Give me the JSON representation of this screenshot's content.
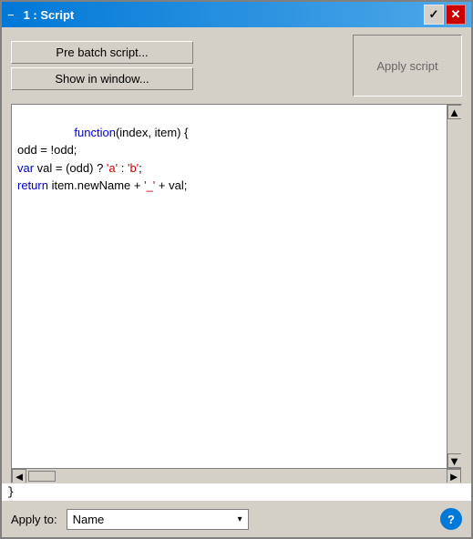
{
  "window": {
    "title": "1 : Script",
    "minus_label": "−"
  },
  "toolbar": {
    "pre_batch_label": "Pre batch script...",
    "show_in_window_label": "Show in window...",
    "apply_script_label": "Apply script"
  },
  "code": {
    "lines": [
      {
        "parts": [
          {
            "text": "function",
            "class": "kw-blue"
          },
          {
            "text": "(index, item) {",
            "class": "kw-black"
          }
        ]
      },
      {
        "parts": [
          {
            "text": "odd",
            "class": "kw-black"
          },
          {
            "text": " = ",
            "class": "kw-black"
          },
          {
            "text": "!",
            "class": "kw-black"
          },
          {
            "text": "odd",
            "class": "kw-black"
          },
          {
            "text": ";",
            "class": "kw-black"
          }
        ]
      },
      {
        "parts": [
          {
            "text": "var",
            "class": "kw-blue"
          },
          {
            "text": " val = (",
            "class": "kw-black"
          },
          {
            "text": "odd",
            "class": "kw-black"
          },
          {
            "text": ") ? ",
            "class": "kw-black"
          },
          {
            "text": "'a'",
            "class": "kw-red"
          },
          {
            "text": " : ",
            "class": "kw-black"
          },
          {
            "text": "'b'",
            "class": "kw-red"
          },
          {
            "text": ";",
            "class": "kw-black"
          }
        ]
      },
      {
        "parts": [
          {
            "text": "return",
            "class": "kw-blue"
          },
          {
            "text": " item.newName + ",
            "class": "kw-black"
          },
          {
            "text": "'_'",
            "class": "kw-red"
          },
          {
            "text": " + val;",
            "class": "kw-black"
          }
        ]
      }
    ],
    "closing_brace": "}"
  },
  "bottom": {
    "apply_to_label": "Apply to:",
    "dropdown_value": "Name",
    "dropdown_arrow": "▾"
  },
  "help": {
    "label": "?"
  },
  "icons": {
    "check": "✓",
    "close": "✕",
    "arrow_up": "▲",
    "arrow_down": "▼",
    "arrow_left": "◄",
    "arrow_right": "►"
  }
}
